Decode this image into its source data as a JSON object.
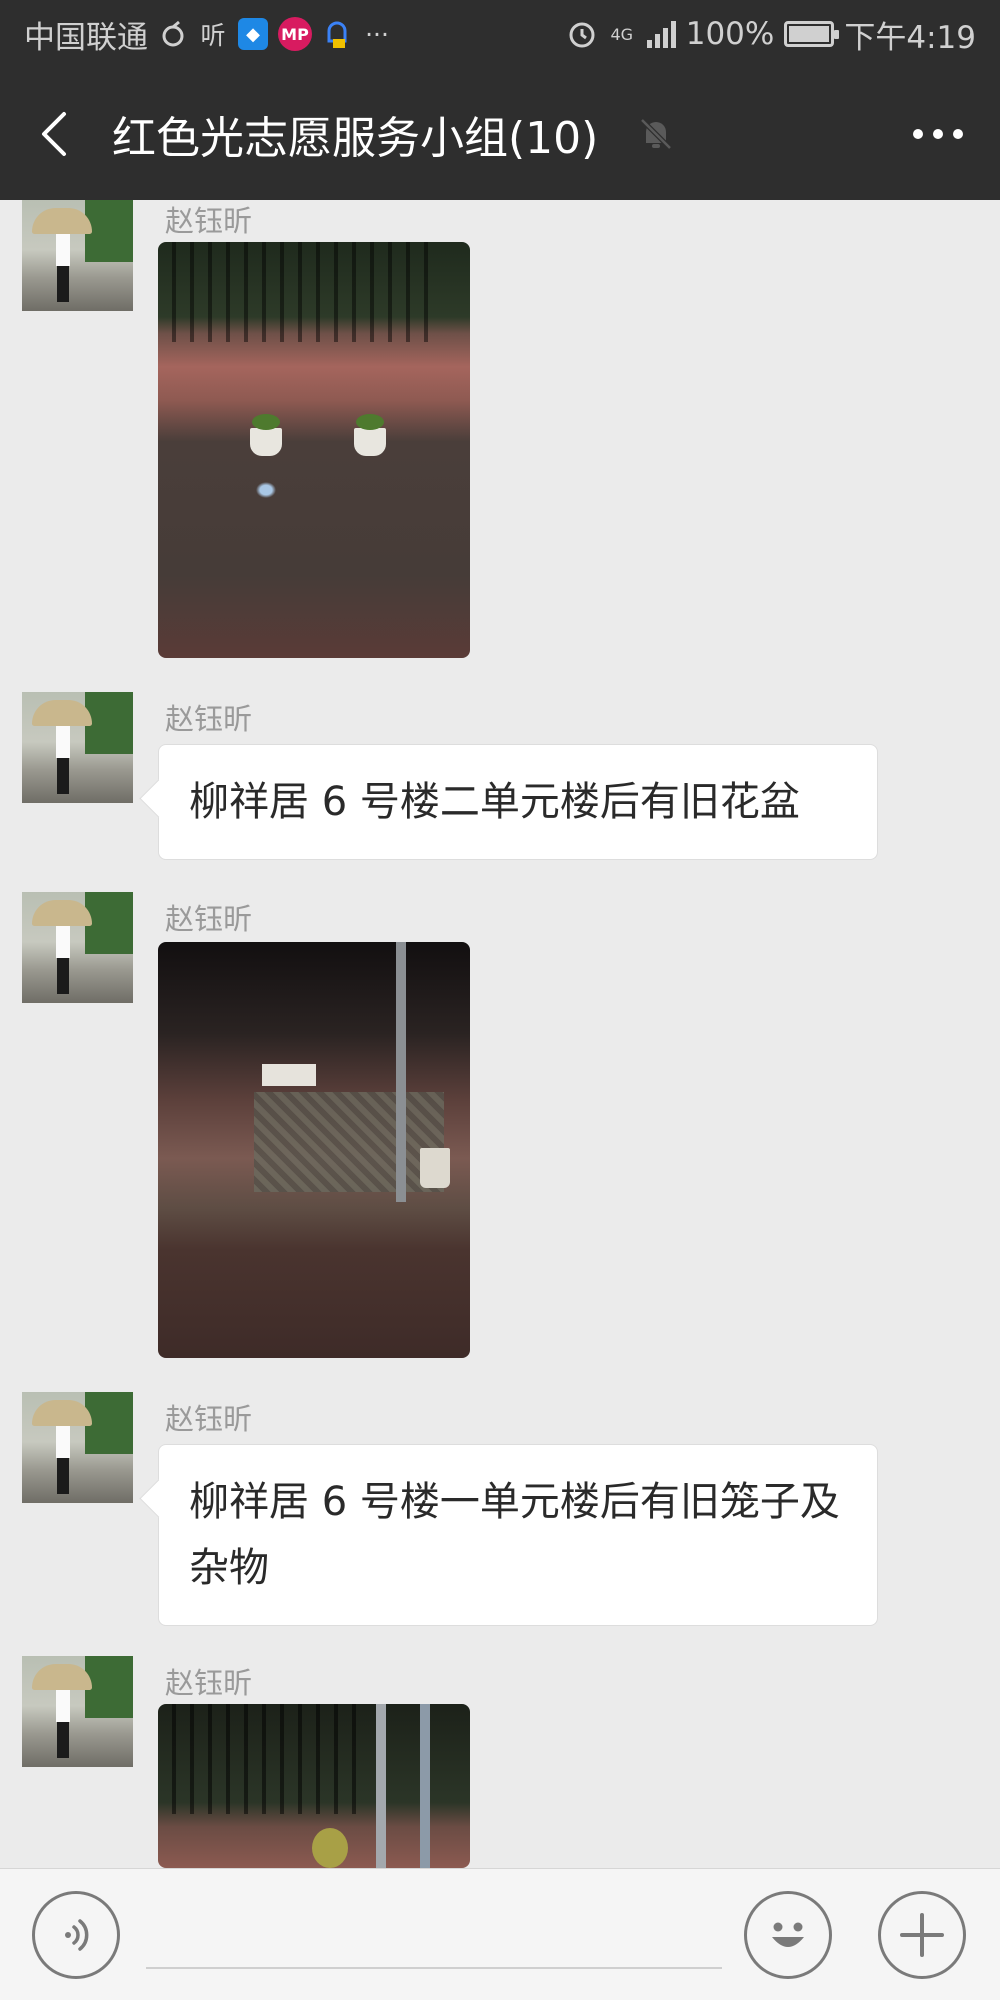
{
  "status_bar": {
    "carrier": "中国联通",
    "icons_left": [
      "sync-icon",
      "ting-app-icon",
      "shield-app-icon",
      "mp-app-icon",
      "bell-app-icon",
      "more-dots-icon"
    ],
    "ting_label": "听",
    "mp_label": "MP",
    "overflow": "···",
    "network": "4G",
    "battery_percent": "100%",
    "battery_level": 1.0,
    "time": "下午4:19"
  },
  "header": {
    "title": "红色光志愿服务小组(10)",
    "muted": true
  },
  "messages": [
    {
      "type": "image",
      "sender": "赵钰昕"
    },
    {
      "type": "text",
      "sender": "赵钰昕",
      "text": "柳祥居 6 号楼二单元楼后有旧花盆"
    },
    {
      "type": "image",
      "sender": "赵钰昕"
    },
    {
      "type": "text",
      "sender": "赵钰昕",
      "text": "柳祥居 6 号楼一单元楼后有旧笼子及杂物"
    },
    {
      "type": "image",
      "sender": "赵钰昕"
    }
  ],
  "input_bar": {
    "placeholder": ""
  },
  "colors": {
    "header_bg": "#2e2e2e",
    "chat_bg": "#ebebeb",
    "bubble_bg": "#ffffff",
    "sender_name": "#9a9a9a"
  }
}
